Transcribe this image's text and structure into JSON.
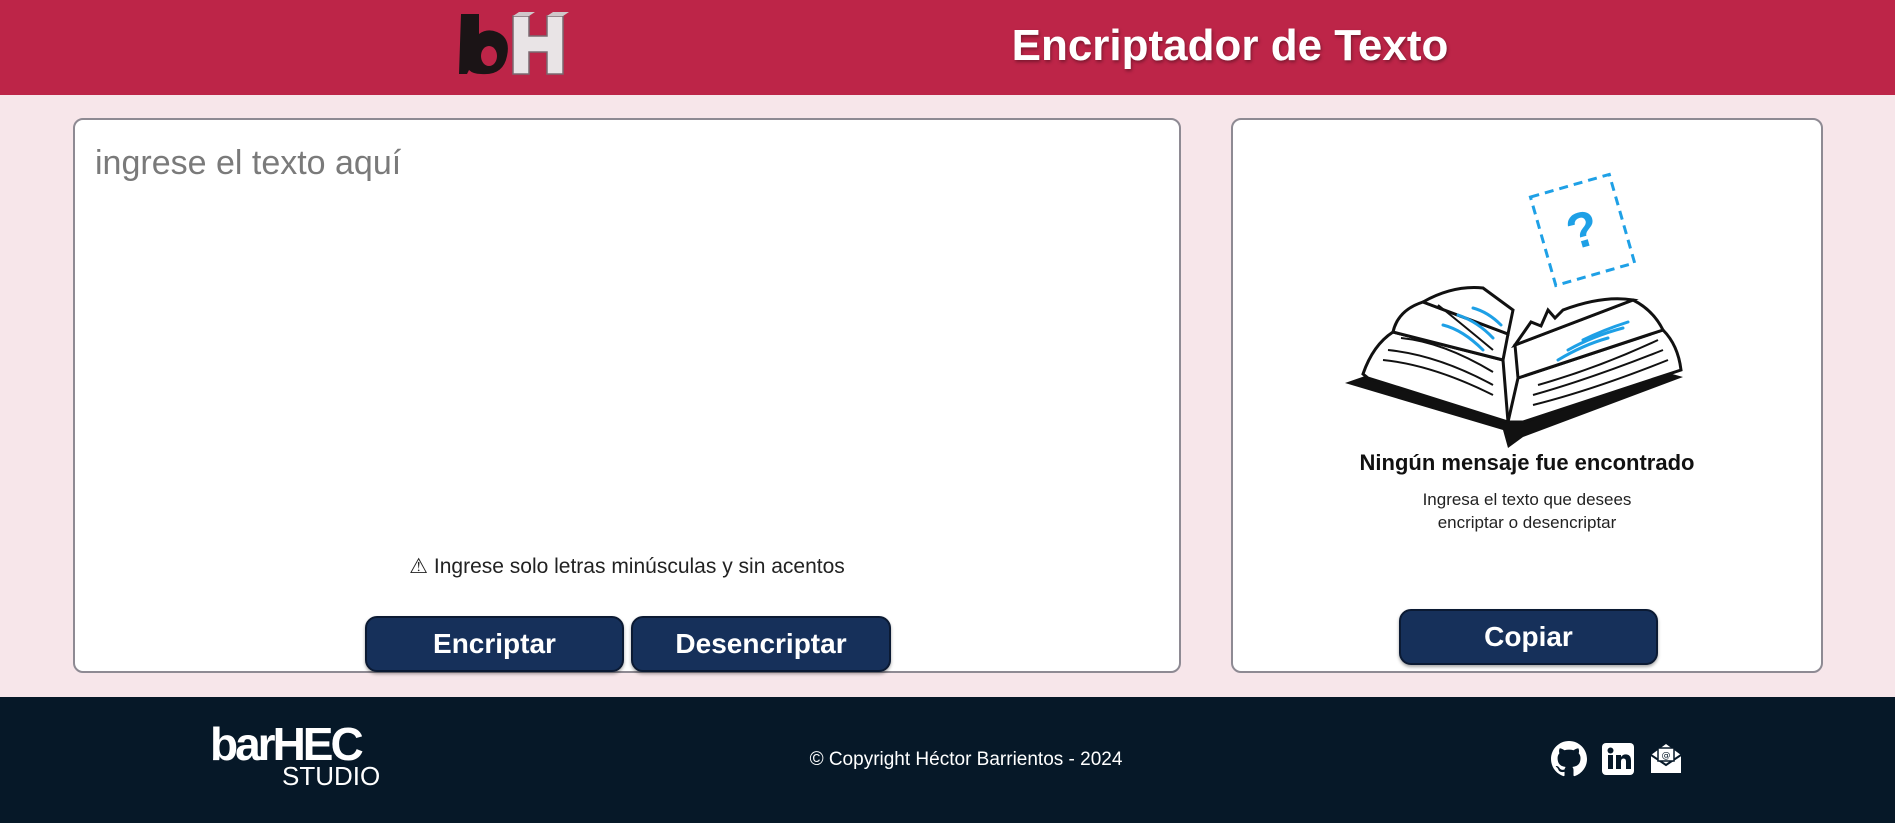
{
  "header": {
    "logo_text": "bH",
    "title": "Encriptador de Texto"
  },
  "input": {
    "placeholder": "ingrese el texto aquí",
    "warning": "⚠ Ingrese solo letras minúsculas y sin acentos",
    "encrypt_label": "Encriptar",
    "decrypt_label": "Desencriptar"
  },
  "output": {
    "empty_title": "Ningún mensaje fue encontrado",
    "empty_line1": "Ingresa el texto que desees",
    "empty_line2": "encriptar o desencriptar",
    "copy_label": "Copiar"
  },
  "footer": {
    "brand_main": "barHEC",
    "brand_sub": "STUDIO",
    "copyright": "© Copyright Héctor Barrientos - 2024",
    "icons": [
      "github-icon",
      "linkedin-icon",
      "email-icon"
    ]
  },
  "colors": {
    "header_bg": "#bd2548",
    "page_bg": "#f7e6ea",
    "button_bg": "#16305a",
    "footer_bg": "#061828",
    "accent_blue": "#1ea0e6"
  }
}
